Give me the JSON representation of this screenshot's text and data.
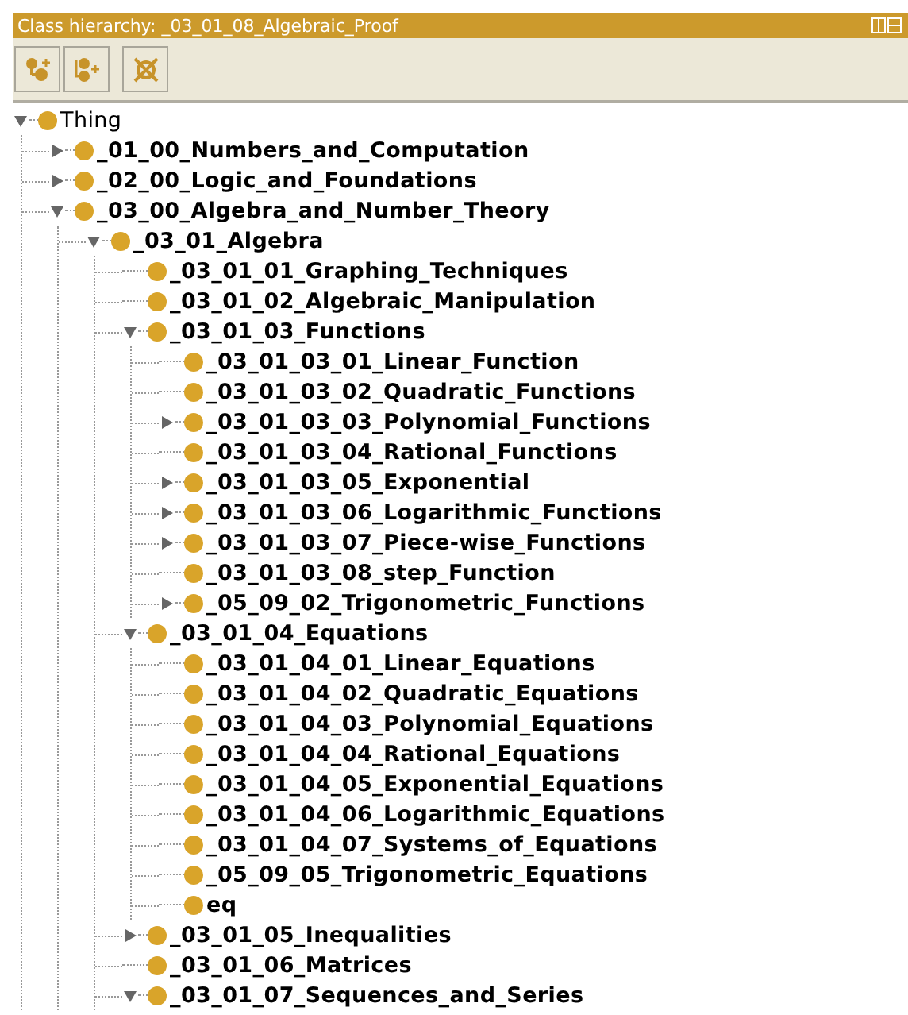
{
  "window": {
    "title": "Class hierarchy: _03_01_08_Algebraic_Proof"
  },
  "toolbar": [
    {
      "kind": "add-subclass"
    },
    {
      "kind": "add-sibling"
    },
    {
      "kind": "delete"
    }
  ],
  "tree": [
    {
      "label": "Thing",
      "kind": "branch",
      "expanded": true,
      "children": [
        {
          "label": "_01_00_Numbers_and_Computation",
          "kind": "branch",
          "expanded": false
        },
        {
          "label": "_02_00_Logic_and_Foundations",
          "kind": "branch",
          "expanded": false
        },
        {
          "label": "_03_00_Algebra_and_Number_Theory",
          "kind": "branch",
          "expanded": true,
          "children": [
            {
              "label": "_03_01_Algebra",
              "kind": "branch",
              "expanded": true,
              "children": [
                {
                  "label": "_03_01_01_Graphing_Techniques",
                  "kind": "leaf"
                },
                {
                  "label": "_03_01_02_Algebraic_Manipulation",
                  "kind": "leaf"
                },
                {
                  "label": "_03_01_03_Functions",
                  "kind": "branch",
                  "expanded": true,
                  "children": [
                    {
                      "label": "_03_01_03_01_Linear_Function",
                      "kind": "leaf"
                    },
                    {
                      "label": "_03_01_03_02_Quadratic_Functions",
                      "kind": "leaf"
                    },
                    {
                      "label": "_03_01_03_03_Polynomial_Functions",
                      "kind": "branch",
                      "expanded": false
                    },
                    {
                      "label": "_03_01_03_04_Rational_Functions",
                      "kind": "leaf"
                    },
                    {
                      "label": "_03_01_03_05_Exponential",
                      "kind": "branch",
                      "expanded": false
                    },
                    {
                      "label": "_03_01_03_06_Logarithmic_Functions",
                      "kind": "branch",
                      "expanded": false
                    },
                    {
                      "label": "_03_01_03_07_Piece-wise_Functions",
                      "kind": "branch",
                      "expanded": false
                    },
                    {
                      "label": "_03_01_03_08_step_Function",
                      "kind": "leaf"
                    },
                    {
                      "label": "_05_09_02_Trigonometric_Functions",
                      "kind": "branch",
                      "expanded": false
                    }
                  ]
                },
                {
                  "label": "_03_01_04_Equations",
                  "kind": "branch",
                  "expanded": true,
                  "children": [
                    {
                      "label": "_03_01_04_01_Linear_Equations",
                      "kind": "leaf"
                    },
                    {
                      "label": "_03_01_04_02_Quadratic_Equations",
                      "kind": "leaf"
                    },
                    {
                      "label": "_03_01_04_03_Polynomial_Equations",
                      "kind": "leaf"
                    },
                    {
                      "label": "_03_01_04_04_Rational_Equations",
                      "kind": "leaf"
                    },
                    {
                      "label": "_03_01_04_05_Exponential_Equations",
                      "kind": "leaf"
                    },
                    {
                      "label": "_03_01_04_06_Logarithmic_Equations",
                      "kind": "leaf"
                    },
                    {
                      "label": "_03_01_04_07_Systems_of_Equations",
                      "kind": "leaf"
                    },
                    {
                      "label": "_05_09_05_Trigonometric_Equations",
                      "kind": "leaf"
                    },
                    {
                      "label": "eq",
                      "kind": "leaf"
                    }
                  ]
                },
                {
                  "label": "_03_01_05_Inequalities",
                  "kind": "branch",
                  "expanded": false
                },
                {
                  "label": "_03_01_06_Matrices",
                  "kind": "leaf"
                },
                {
                  "label": "_03_01_07_Sequences_and_Series",
                  "kind": "branch",
                  "expanded": true
                }
              ]
            }
          ]
        }
      ]
    }
  ]
}
